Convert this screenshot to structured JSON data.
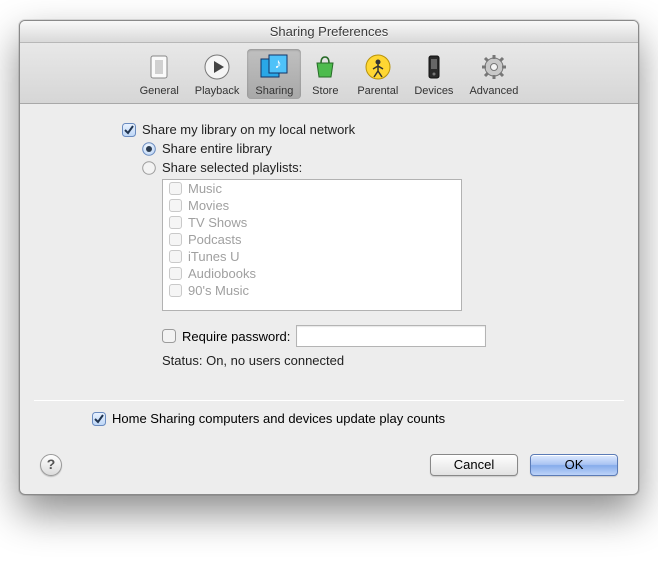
{
  "window": {
    "title": "Sharing Preferences"
  },
  "toolbar": {
    "items": [
      {
        "label": "General"
      },
      {
        "label": "Playback"
      },
      {
        "label": "Sharing"
      },
      {
        "label": "Store"
      },
      {
        "label": "Parental"
      },
      {
        "label": "Devices"
      },
      {
        "label": "Advanced"
      }
    ]
  },
  "share_local_label": "Share my library on my local network",
  "share_entire_label": "Share entire library",
  "share_selected_label": "Share selected playlists:",
  "playlists": [
    "Music",
    "Movies",
    "TV Shows",
    "Podcasts",
    "iTunes U",
    "Audiobooks",
    "90's Music"
  ],
  "require_password_label": "Require password:",
  "status_label": "Status: On, no users connected",
  "home_sharing_label": "Home Sharing computers and devices update play counts",
  "help_label": "?",
  "buttons": {
    "cancel": "Cancel",
    "ok": "OK"
  }
}
